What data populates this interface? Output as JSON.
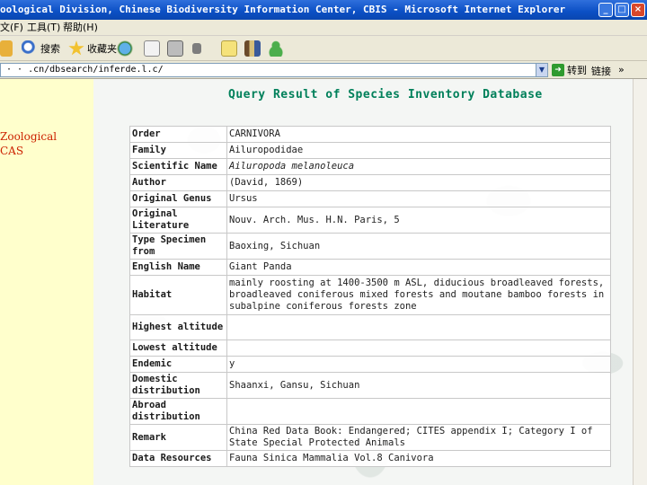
{
  "window": {
    "title": "oological Division, Chinese Biodiversity Information Center, CBIS - Microsoft Internet Explorer",
    "buttons": [
      "_",
      "□",
      "×"
    ]
  },
  "menu": {
    "items": [
      "文(F)",
      "工具(T)",
      "帮助(H)"
    ]
  },
  "toolbar": {
    "search_label": "搜索",
    "favorites_label": "收藏夹"
  },
  "address": {
    "value": "· · .cn/dbsearch/inferde.l.c/",
    "go_label": "转到",
    "links_label": "链接"
  },
  "left_panel": {
    "label_line1": "Zoological",
    "label_line2": "CAS"
  },
  "page": {
    "heading": "Query Result of Species Inventory Database"
  },
  "records": [
    {
      "label": "Order",
      "value": "CARNIVORA"
    },
    {
      "label": "Family",
      "value": "Ailuropodidae"
    },
    {
      "label": "Scientific Name",
      "value": "Ailuropoda melanoleuca",
      "italic": true
    },
    {
      "label": "Author",
      "value": "(David, 1869)"
    },
    {
      "label": "Original Genus",
      "value": "Ursus"
    },
    {
      "label": "Original Literature",
      "value": "Nouv. Arch. Mus. H.N. Paris, 5"
    },
    {
      "label": "Type Specimen from",
      "value": "Baoxing, Sichuan"
    },
    {
      "label": "English Name",
      "value": "Giant Panda"
    },
    {
      "label": "Habitat",
      "value": "mainly roosting at 1400-3500 m ASL, diducious broadleaved forests, broadleaved coniferous mixed forests and moutane bamboo forests in subalpine coniferous forests zone"
    },
    {
      "label": "Highest altitude",
      "value": ""
    },
    {
      "label": "Lowest altitude",
      "value": ""
    },
    {
      "label": "Endemic",
      "value": "y"
    },
    {
      "label": "Domestic distribution",
      "value": "Shaanxi, Gansu, Sichuan"
    },
    {
      "label": "Abroad distribution",
      "value": ""
    },
    {
      "label": "Remark",
      "value": "China Red Data Book: Endangered; CITES appendix I; Category I of State Special Protected Animals"
    },
    {
      "label": "Data Resources",
      "value": "Fauna Sinica Mammalia Vol.8 Canivora"
    }
  ]
}
